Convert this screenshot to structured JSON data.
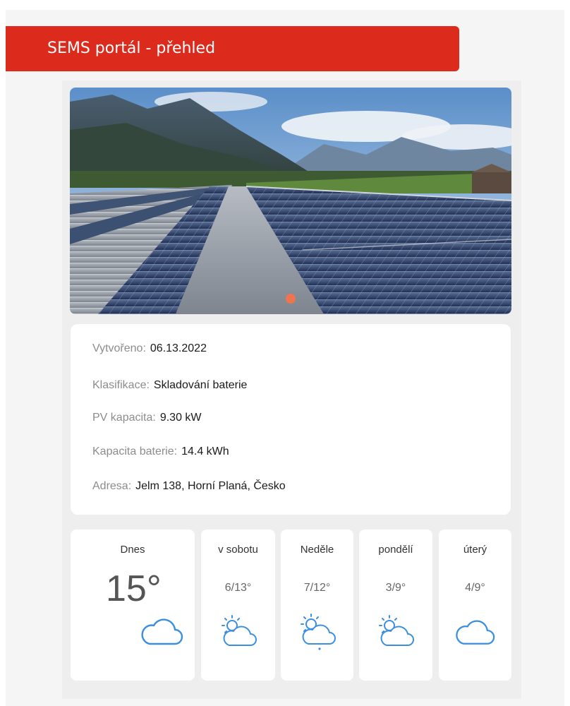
{
  "header": {
    "title": "SEMS portál - přehled"
  },
  "hero": {
    "image": "solar-panels-mountains-photo",
    "carousel_active_index": 0
  },
  "info": {
    "rows": [
      {
        "label": "Vytvořeno:",
        "value": "06.13.2022"
      },
      {
        "label": "Klasifikace:",
        "value": "Skladování baterie"
      },
      {
        "label": "PV kapacita:",
        "value": "9.30 kW"
      },
      {
        "label": "Kapacita baterie:",
        "value": "14.4 kWh"
      },
      {
        "label": "Adresa:",
        "value": "Jelm 138, Horní Planá, Česko"
      }
    ]
  },
  "weather": {
    "icon_color": "#3b8fe0",
    "today": {
      "label": "Dnes",
      "temp": "15°",
      "icon": "cloud-icon"
    },
    "forecast": [
      {
        "label": "v sobotu",
        "temp": "6/13°",
        "icon": "partly-cloudy-icon"
      },
      {
        "label": "Neděle",
        "temp": "7/12°",
        "icon": "partly-cloudy-rain-icon"
      },
      {
        "label": "pondělí",
        "temp": "3/9°",
        "icon": "partly-cloudy-icon"
      },
      {
        "label": "úterý",
        "temp": "4/9°",
        "icon": "cloud-icon"
      }
    ]
  }
}
